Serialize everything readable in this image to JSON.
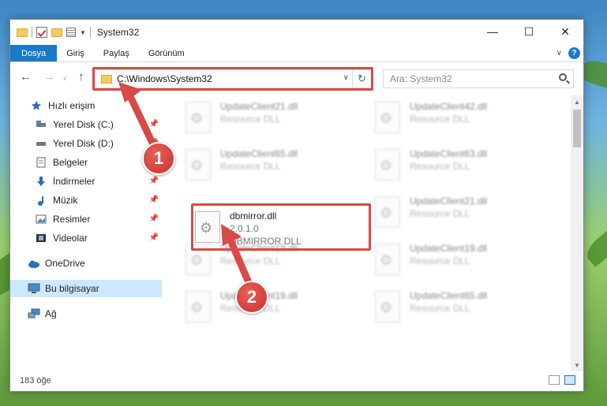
{
  "window": {
    "title": "System32",
    "controls": {
      "minimize": "—",
      "maximize": "☐",
      "close": "✕"
    }
  },
  "ribbon": {
    "tabs": [
      "Dosya",
      "Giriş",
      "Paylaş",
      "Görünüm"
    ]
  },
  "navigation": {
    "address": "C:\\Windows\\System32",
    "search_placeholder": "Ara: System32"
  },
  "sidebar": {
    "items": [
      {
        "label": "Hızlı erişim",
        "icon": "star-icon",
        "pinned": false
      },
      {
        "label": "Yerel Disk (C:)",
        "icon": "drive-icon",
        "pinned": true
      },
      {
        "label": "Yerel Disk (D:)",
        "icon": "drive-icon",
        "pinned": true
      },
      {
        "label": "Belgeler",
        "icon": "documents-icon",
        "pinned": true
      },
      {
        "label": "İndirmeler",
        "icon": "download-icon",
        "pinned": true
      },
      {
        "label": "Müzik",
        "icon": "music-icon",
        "pinned": true
      },
      {
        "label": "Resimler",
        "icon": "pictures-icon",
        "pinned": true
      },
      {
        "label": "Videolar",
        "icon": "videos-icon",
        "pinned": true
      },
      {
        "label": "OneDrive",
        "icon": "cloud-icon",
        "pinned": false
      },
      {
        "label": "Bu bilgisayar",
        "icon": "computer-icon",
        "pinned": false,
        "selected": true
      },
      {
        "label": "Ağ",
        "icon": "network-icon",
        "pinned": false
      }
    ]
  },
  "files": {
    "background": [
      {
        "name": "UpdateClient21.dll",
        "sub": "Resource DLL"
      },
      {
        "name": "UpdateClient42.dll",
        "sub": "Resource DLL"
      },
      {
        "name": "UpdateClient65.dll",
        "sub": "Resource DLL"
      },
      {
        "name": "UpdateClient63.dll",
        "sub": "Resource DLL"
      },
      {
        "name": "UpdateClient21.dll",
        "sub": "Resource DLL"
      },
      {
        "name": "UpdateClient19.dll",
        "sub": "Resource DLL"
      },
      {
        "name": "UpdateClient19.dll",
        "sub": "Resource DLL"
      },
      {
        "name": "UpdateClient19.dll",
        "sub": "Resource DLL"
      },
      {
        "name": "UpdateClient65.dll",
        "sub": "Resource DLL"
      }
    ],
    "focus": {
      "name": "dbmirror.dll",
      "version": "2.0.1.0",
      "description": "DBMIRROR DLL"
    }
  },
  "status": {
    "count": "183 öğe"
  },
  "annotations": {
    "step1": "1",
    "step2": "2",
    "color": "#d84a48"
  }
}
